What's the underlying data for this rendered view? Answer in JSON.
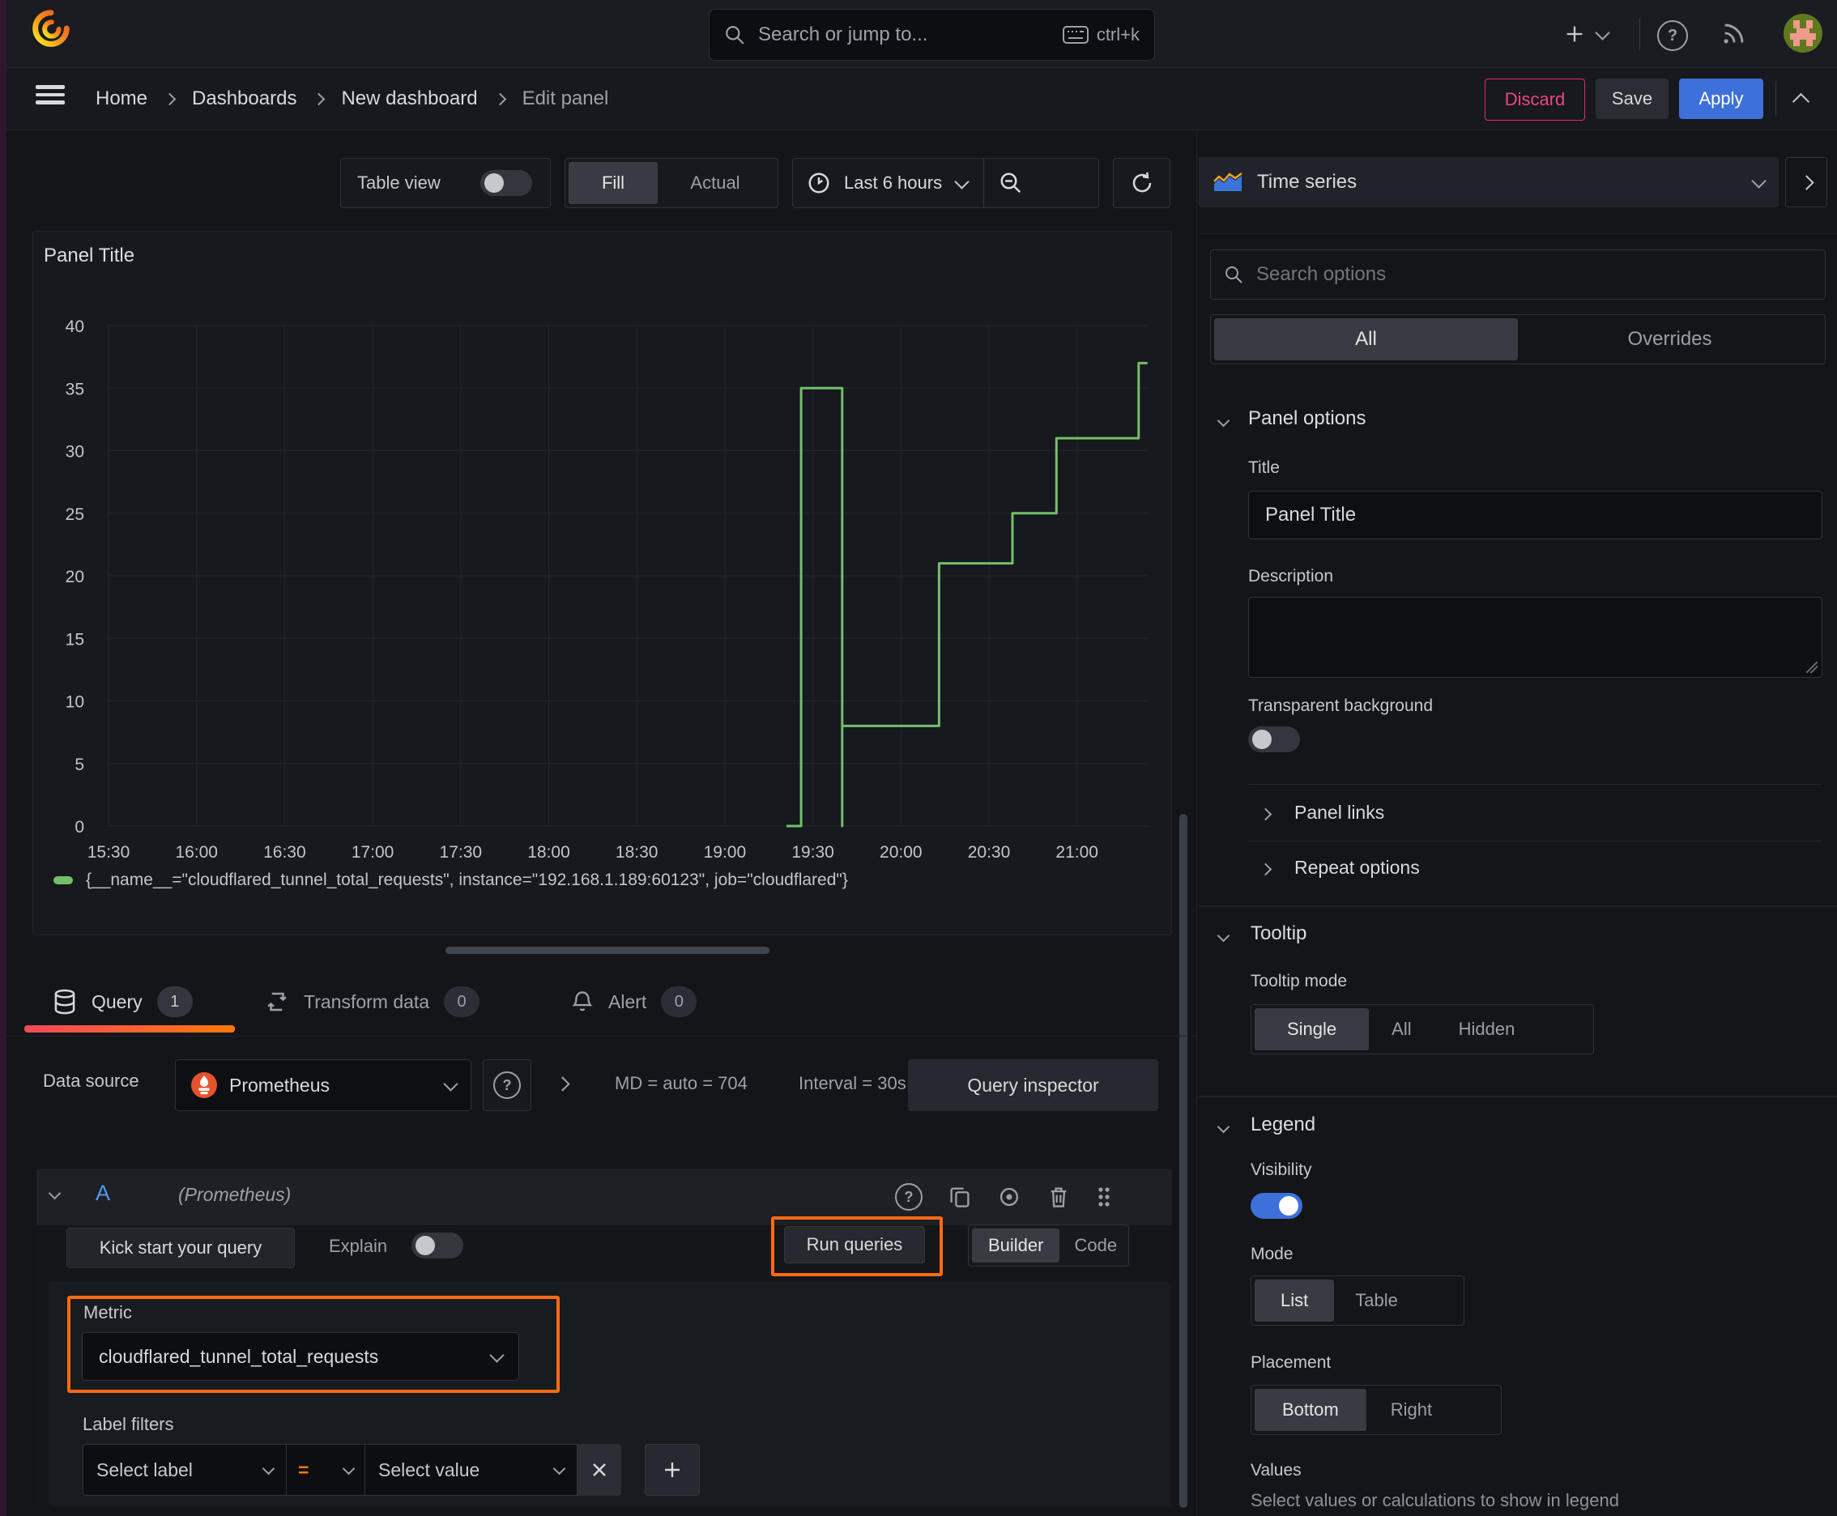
{
  "topbar": {
    "search_placeholder": "Search or jump to...",
    "shortcut": "ctrl+k"
  },
  "breadcrumb": {
    "items": [
      "Home",
      "Dashboards",
      "New dashboard",
      "Edit panel"
    ]
  },
  "actions": {
    "discard": "Discard",
    "save": "Save",
    "apply": "Apply"
  },
  "panel_toolbar": {
    "table_view": "Table view",
    "fill": "Fill",
    "actual": "Actual",
    "time_range": "Last 6 hours"
  },
  "panel": {
    "title": "Panel Title"
  },
  "chart_data": {
    "type": "line",
    "step": true,
    "title": "Panel Title",
    "xlabel": "",
    "ylabel": "",
    "x_start": "15:30",
    "x_ticks": [
      "15:30",
      "16:00",
      "16:30",
      "17:00",
      "17:30",
      "18:00",
      "18:30",
      "19:00",
      "19:30",
      "20:00",
      "20:30",
      "21:00"
    ],
    "y_ticks": [
      0,
      5,
      10,
      15,
      20,
      25,
      30,
      35,
      40
    ],
    "ylim": [
      0,
      40
    ],
    "grid": true,
    "legend_position": "bottom",
    "series": [
      {
        "name": "{__name__=\"cloudflared_tunnel_total_requests\", instance=\"192.168.1.189:60123\", job=\"cloudflared\"}",
        "color": "#73BF69",
        "points": [
          [
            "19:21",
            0
          ],
          [
            "19:26",
            0
          ],
          [
            "19:26",
            35
          ],
          [
            "19:40",
            35
          ],
          [
            "19:40",
            0
          ],
          [
            "19:40",
            8
          ],
          [
            "20:13",
            8
          ],
          [
            "20:13",
            21
          ],
          [
            "20:38",
            21
          ],
          [
            "20:38",
            25
          ],
          [
            "20:53",
            25
          ],
          [
            "20:53",
            31
          ],
          [
            "21:21",
            31
          ],
          [
            "21:21",
            37
          ],
          [
            "21:24",
            37
          ]
        ]
      }
    ]
  },
  "query": {
    "tabs": [
      {
        "label": "Query",
        "badge": "1"
      },
      {
        "label": "Transform data",
        "badge": "0"
      },
      {
        "label": "Alert",
        "badge": "0"
      }
    ],
    "datasource_label": "Data source",
    "datasource_value": "Prometheus",
    "stats_md": "MD = auto = 704",
    "stats_interval": "Interval = 30s",
    "inspector": "Query inspector",
    "row_ref": "A",
    "row_ds": "(Prometheus)",
    "kick_start": "Kick start your query",
    "explain": "Explain",
    "run_queries": "Run queries",
    "builder": "Builder",
    "code": "Code",
    "metric_label": "Metric",
    "metric_value": "cloudflared_tunnel_total_requests",
    "label_filters": "Label filters",
    "select_label": "Select label",
    "operator": "=",
    "select_value": "Select value"
  },
  "sidebar": {
    "viz_type": "Time series",
    "search_placeholder": "Search options",
    "tabs": {
      "all": "All",
      "overrides": "Overrides"
    },
    "panel_options": {
      "heading": "Panel options",
      "title_label": "Title",
      "title_value": "Panel Title",
      "description_label": "Description",
      "transparent_label": "Transparent background"
    },
    "collapsed": {
      "panel_links": "Panel links",
      "repeat_options": "Repeat options"
    },
    "tooltip": {
      "heading": "Tooltip",
      "mode_label": "Tooltip mode",
      "modes": [
        "Single",
        "All",
        "Hidden"
      ],
      "selected": "Single"
    },
    "legend": {
      "heading": "Legend",
      "visibility_label": "Visibility",
      "mode_label": "Mode",
      "modes": [
        "List",
        "Table"
      ],
      "selected_mode": "List",
      "placement_label": "Placement",
      "placements": [
        "Bottom",
        "Right"
      ],
      "selected_placement": "Bottom",
      "values_label": "Values",
      "values_help": "Select values or calculations to show in legend"
    }
  },
  "colors": {
    "accent_orange": "#FF780A",
    "highlight_box": "#FF6A13",
    "blue": "#3D71D9",
    "green": "#73BF69",
    "discard_red": "#E5286B"
  },
  "icons": {
    "grafana-logo": "orange spiral flame",
    "search-icon": "magnifier",
    "keyboard-icon": "keyboard glyph",
    "add-icon": "plus",
    "help-icon": "question circle",
    "news-icon": "rss arcs",
    "avatar": "pixel-art avatar on green circle",
    "menu-icon": "hamburger",
    "clock-icon": "clock",
    "zoom-out-icon": "magnifier minus",
    "refresh-icon": "circular arrow",
    "database-icon": "db cylinder",
    "transform-icon": "cycle arrows",
    "bell-icon": "bell",
    "prometheus-icon": "white torch on orange circle",
    "timeseries-icon": "blue area with orange line",
    "copy-icon": "two sheets",
    "eye-icon": "eye",
    "trash-icon": "trash can",
    "drag-handle-icon": "six dots",
    "close-icon": "x"
  }
}
